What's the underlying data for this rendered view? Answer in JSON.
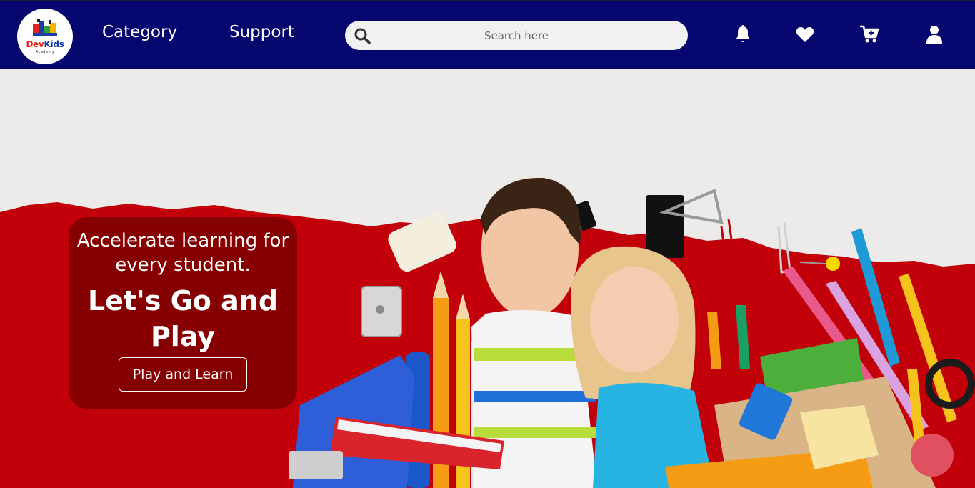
{
  "brand": {
    "name_part1": "Dev",
    "name_part2": "Kids",
    "tagline": "Academy"
  },
  "nav": {
    "links": [
      {
        "label": "Category"
      },
      {
        "label": "Support"
      }
    ]
  },
  "search": {
    "placeholder": "Search here",
    "value": ""
  },
  "icons": {
    "search": "search-icon",
    "notifications": "bell-icon",
    "wishlist": "heart-icon",
    "cart": "cart-icon",
    "account": "user-icon"
  },
  "hero": {
    "subtitle": "Accelerate learning for every student.",
    "title": "Let's Go and Play",
    "cta_label": "Play and Learn"
  },
  "colors": {
    "nav_background": "#05066e",
    "hero_red": "#c1000a",
    "promo_panel": "#7d0000",
    "paper": "#ecebea"
  }
}
